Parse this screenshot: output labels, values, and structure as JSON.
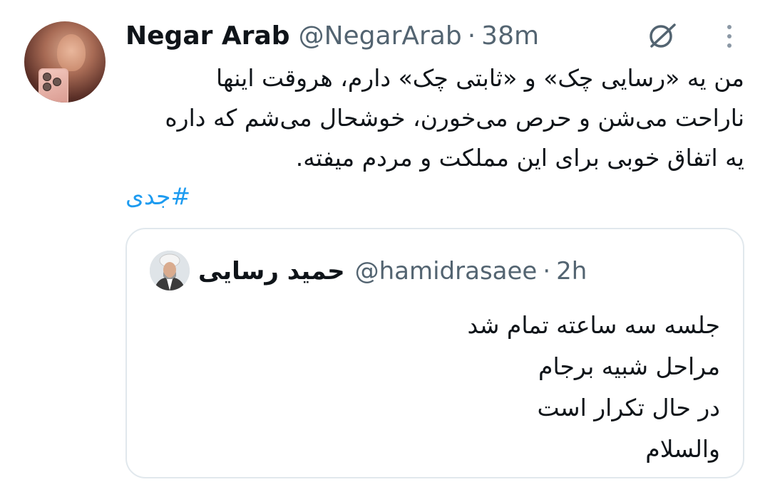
{
  "tweet": {
    "author_name": "Negar Arab",
    "author_handle": "@NegarArab",
    "separator": "·",
    "time": "38m",
    "body_lines": [
      "من یه «رسایی چک» و «ثابتی چک» دارم، هروقت اینها",
      "ناراحت می‌شن و حرص می‌خورن، خوشحال می‌شم که داره",
      "یه اتفاق خوبی برای این مملکت و مردم میفته."
    ],
    "hashtag": "#جدی",
    "icons": {
      "grok": "grok-icon",
      "more": "more-vertical-icon"
    }
  },
  "quote": {
    "author_name": "حمید رسایی",
    "author_handle": "@hamidrasaee",
    "separator": "·",
    "time": "2h",
    "lines": [
      "جلسه سه ساعته تمام شد",
      "مراحل شبیه برجام",
      "در حال تکرار است",
      "والسلام"
    ]
  },
  "colors": {
    "text": "#0f1419",
    "secondary": "#536471",
    "link": "#1d9bf0",
    "border": "#e1e8ed"
  }
}
